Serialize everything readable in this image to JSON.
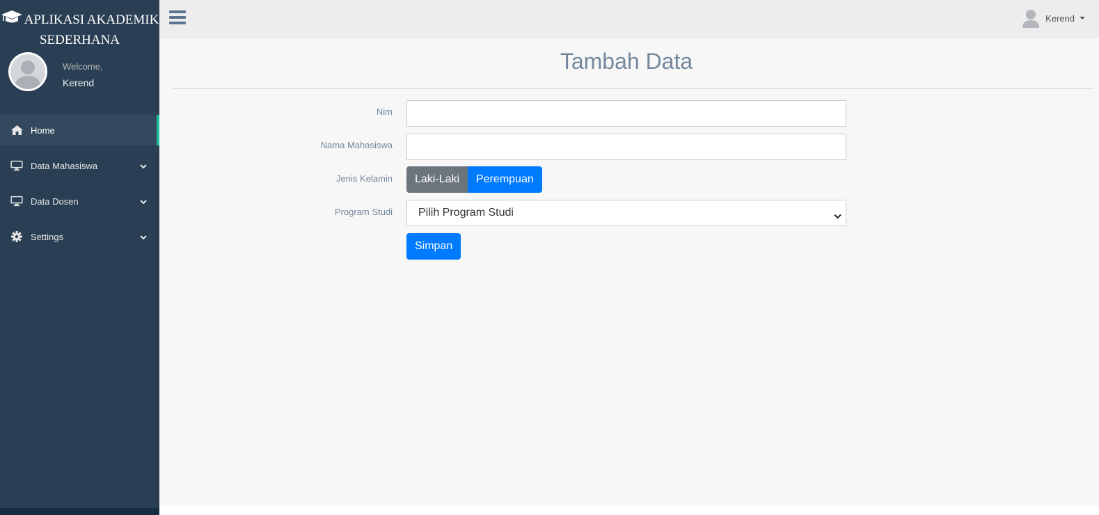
{
  "app": {
    "brand_line1": "APLIKASI AKADEMIK",
    "brand_line2": "SEDERHANA"
  },
  "profile": {
    "welcome": "Welcome,",
    "name": "Kerend"
  },
  "sidebar": {
    "items": [
      {
        "label": "Home",
        "icon": "home-icon",
        "active": true
      },
      {
        "label": "Data Mahasiswa",
        "icon": "desktop-icon"
      },
      {
        "label": "Data Dosen",
        "icon": "desktop-icon"
      },
      {
        "label": "Settings",
        "icon": "gear-icon"
      }
    ]
  },
  "topbar": {
    "user_name": "Kerend"
  },
  "page": {
    "title": "Tambah Data"
  },
  "form": {
    "nim_label": "Nim",
    "nim_value": "",
    "nama_label": "Nama Mahasiswa",
    "nama_value": "",
    "jenis_label": "Jenis Kelamin",
    "gender_options": [
      "Laki-Laki",
      "Perempuan"
    ],
    "prodi_label": "Program Studi",
    "prodi_selected": "Pilih Program Studi",
    "save_label": "Simpan"
  },
  "colors": {
    "sidebar_bg": "#2a3f54",
    "accent": "#1abb9c",
    "primary": "#007bff",
    "secondary": "#6c757d",
    "title": "#73879c"
  }
}
